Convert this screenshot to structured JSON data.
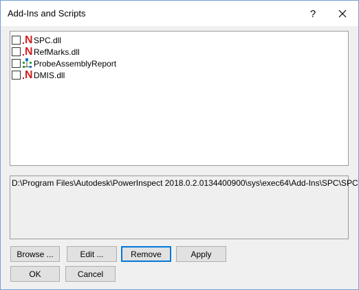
{
  "dialog": {
    "title": "Add-Ins and Scripts",
    "help_glyph": "?"
  },
  "addins": [
    {
      "label": "SPC.dll",
      "icon": "n-addin-icon",
      "checked": false
    },
    {
      "label": "RefMarks.dll",
      "icon": "n-addin-icon",
      "checked": false
    },
    {
      "label": "ProbeAssemblyReport",
      "icon": "script-icon",
      "checked": false
    },
    {
      "label": "DMIS.dll",
      "icon": "n-addin-icon",
      "checked": false
    }
  ],
  "path": {
    "value": "D:\\Program Files\\Autodesk\\PowerInspect 2018.0.2.0134400900\\sys\\exec64\\Add-Ins\\SPC\\SPC.dll"
  },
  "buttons": {
    "browse": "Browse ...",
    "edit": "Edit ...",
    "remove": "Remove",
    "apply": "Apply",
    "ok": "OK",
    "cancel": "Cancel"
  },
  "colors": {
    "accent": "#0078d7",
    "n_icon": "#d21f1f",
    "script_icon": "#1e6fc4"
  }
}
